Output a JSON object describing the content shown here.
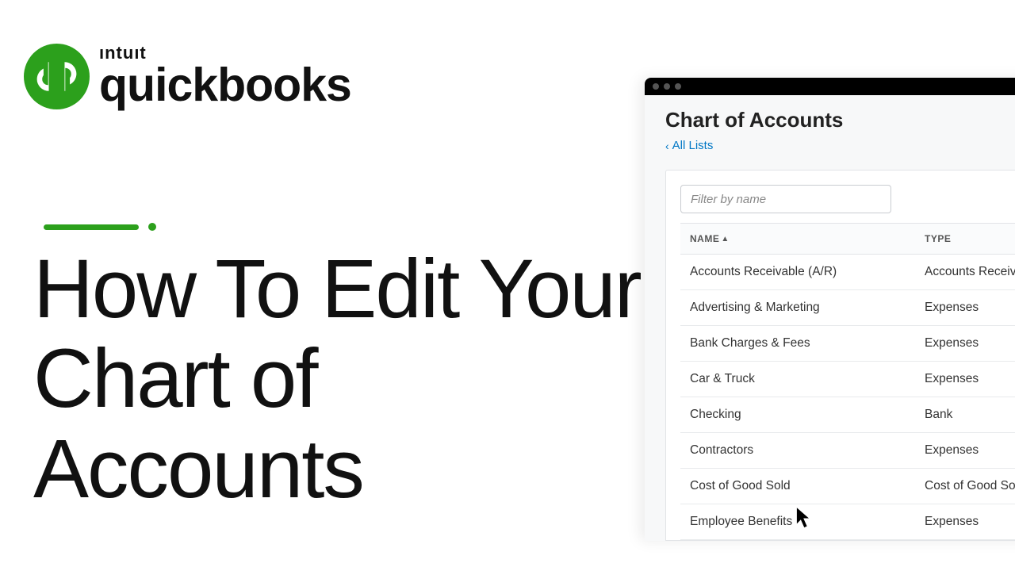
{
  "brand": {
    "intuit": "ıntuıt",
    "product": "quickbooks"
  },
  "headline": "How To Edit Your Chart of Accounts",
  "app": {
    "page_title": "Chart of Accounts",
    "back_link": "All Lists",
    "filter_placeholder": "Filter by name",
    "columns": {
      "name": "NAME",
      "type": "TYPE"
    },
    "rows": [
      {
        "name": "Accounts Receivable (A/R)",
        "type": "Accounts Receivable"
      },
      {
        "name": "Advertising & Marketing",
        "type": "Expenses"
      },
      {
        "name": "Bank Charges & Fees",
        "type": "Expenses"
      },
      {
        "name": "Car & Truck",
        "type": "Expenses"
      },
      {
        "name": "Checking",
        "type": "Bank"
      },
      {
        "name": "Contractors",
        "type": "Expenses"
      },
      {
        "name": "Cost of Good Sold",
        "type": "Cost of Good Sold"
      },
      {
        "name": "Employee Benefits",
        "type": "Expenses"
      }
    ]
  }
}
